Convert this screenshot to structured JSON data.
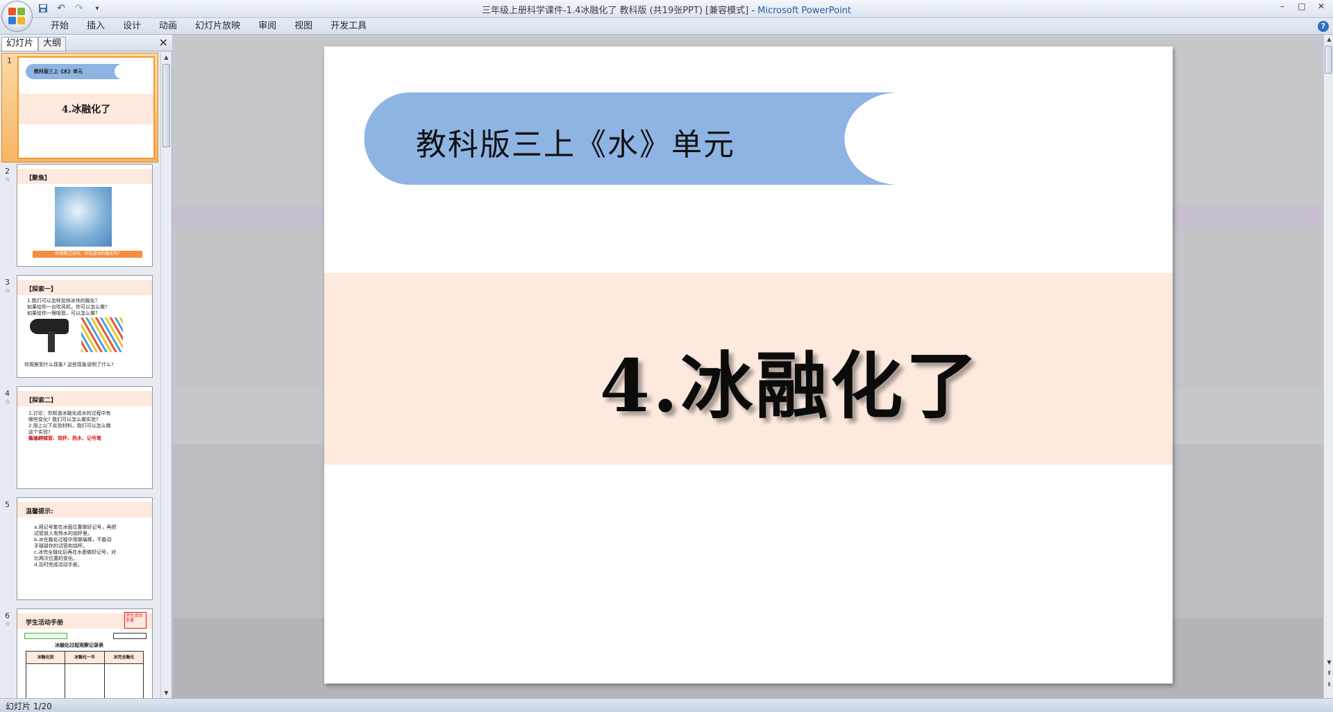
{
  "window": {
    "title": "三年级上册科学课件-1.4冰融化了  教科版  (共19张PPT) [兼容模式] - ",
    "app_name": "Microsoft PowerPoint",
    "controls": [
      "–",
      "□",
      "✕"
    ]
  },
  "quick_access": {
    "save_icon": "save-icon",
    "undo_icon": "undo-icon",
    "redo_icon": "redo-icon",
    "customize": "▾"
  },
  "menu": {
    "tabs": [
      "开始",
      "插入",
      "设计",
      "动画",
      "幻灯片放映",
      "审阅",
      "视图",
      "开发工具"
    ],
    "help": "?"
  },
  "left_pane": {
    "tab_slides": "幻灯片",
    "tab_outline": "大纲",
    "close": "✕"
  },
  "thumbnails": [
    {
      "num": "1",
      "head": "教科版三上《水》单元",
      "title": "4.冰融化了"
    },
    {
      "num": "2",
      "head": "【聚焦】",
      "caption": "你观察过冰吗，你知道冰的融化吗?"
    },
    {
      "num": "3",
      "head": "【探索一】",
      "lines": [
        "1.我们可以怎样加快冰块的融化？",
        "如果给你一台吹风机，你可以怎么做?",
        "如果给你一根吸管，可以怎么做?"
      ],
      "foot": "你观察到什么现象? 这些现象说明了什么?"
    },
    {
      "num": "4",
      "head": "【探索二】",
      "lines": [
        "1.讨论：你知道冰融化成水的过程中有",
        "哪些变化? 我们可以怎么做实验?",
        "2.用上以下实验材料，我们可以怎么做",
        "这个实验?"
      ],
      "materials_label": "实验材料:",
      "materials": "结冰的试管、烧杯、热水、记号笔"
    },
    {
      "num": "5",
      "head": "温馨提示:",
      "lines": [
        "a.用记号笔在冰面位置做好记号，再把",
        "试管放入有热水的烧杯里。",
        "b.冰在融化过程中用玻璃棒，不能动",
        "手碰碰你的试管和烧杯。",
        "c.冰完全融化后再在水面做好记号，对",
        "比两次位置的变化。",
        "d.及时完成活动手册。"
      ]
    },
    {
      "num": "6",
      "head": "学生活动手册",
      "badge": "学生活动手册",
      "table_title": "冰融化过程观察记录表",
      "cols": [
        "冰融化前",
        "冰融化一半",
        "冰完全融化"
      ]
    }
  ],
  "slide": {
    "unit": "教科版三上《水》单元",
    "title": "4.冰融化了",
    "colors": {
      "ribbon": "#8eb4e3",
      "band": "#fde9dd"
    }
  },
  "status": {
    "text": "幻灯片 1/20"
  }
}
